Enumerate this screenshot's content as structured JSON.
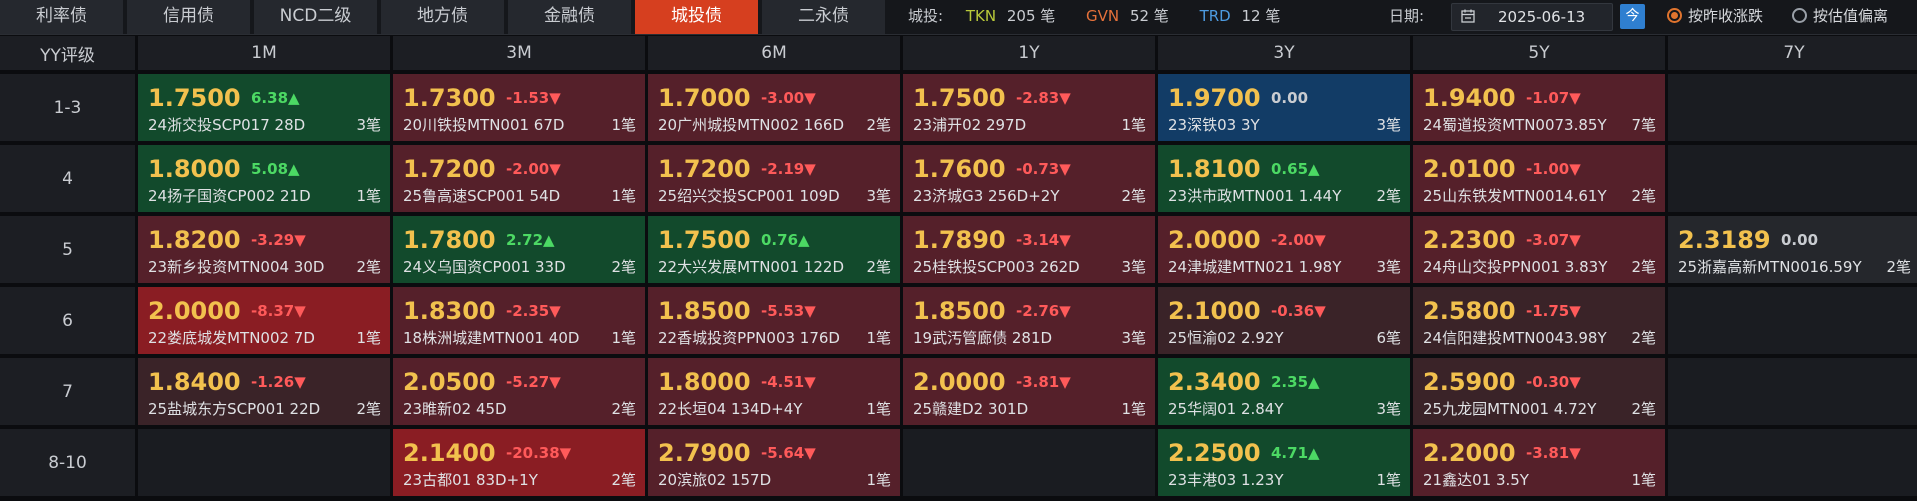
{
  "tabs": [
    {
      "label": "利率债",
      "active": false
    },
    {
      "label": "信用债",
      "active": false
    },
    {
      "label": "NCD二级",
      "active": false
    },
    {
      "label": "地方债",
      "active": false
    },
    {
      "label": "金融债",
      "active": false
    },
    {
      "label": "城投债",
      "active": true
    },
    {
      "label": "二永债",
      "active": false
    }
  ],
  "stats": {
    "label": "城投:",
    "tkn_label": "TKN",
    "tkn_value": "205 笔",
    "gvn_label": "GVN",
    "gvn_value": "52 笔",
    "trd_label": "TRD",
    "trd_value": "12 笔"
  },
  "date": {
    "label": "日期:",
    "value": "2025-06-13",
    "today_label": "今"
  },
  "sort_options": [
    {
      "label": "按昨收涨跌",
      "selected": true
    },
    {
      "label": "按估值偏离",
      "selected": false
    }
  ],
  "colors": {
    "accent": "#d63f1f",
    "up": "#4cd964",
    "down": "#ff5a5a",
    "yield": "#f2c14e",
    "today": "#2f7fd0"
  },
  "grid": {
    "corner": "YY评级",
    "columns": [
      "1M",
      "3M",
      "6M",
      "1Y",
      "3Y",
      "5Y",
      "7Y"
    ],
    "rows": [
      {
        "rating": "1-3",
        "cells": [
          {
            "tone": "g",
            "yield": "1.7500",
            "change": "6.38▲",
            "dir": "up",
            "bond": "24浙交投SCP017 28D",
            "count": "3笔"
          },
          {
            "tone": "r",
            "yield": "1.7300",
            "change": "-1.53▼",
            "dir": "dn",
            "bond": "20川铁投MTN001 67D",
            "count": "1笔"
          },
          {
            "tone": "r",
            "yield": "1.7000",
            "change": "-3.00▼",
            "dir": "dn",
            "bond": "20广州城投MTN002 166D",
            "count": "2笔"
          },
          {
            "tone": "r",
            "yield": "1.7500",
            "change": "-2.83▼",
            "dir": "dn",
            "bond": "23浦开02 297D",
            "count": "1笔"
          },
          {
            "tone": "b",
            "yield": "1.9700",
            "change": "0.00",
            "dir": "flat",
            "bond": "23深铁03 3Y",
            "count": "3笔"
          },
          {
            "tone": "r",
            "yield": "1.9400",
            "change": "-1.07▼",
            "dir": "dn",
            "bond": "24蜀道投资MTN0073.85Y",
            "count": "7笔"
          },
          null
        ]
      },
      {
        "rating": "4",
        "cells": [
          {
            "tone": "g",
            "yield": "1.8000",
            "change": "5.08▲",
            "dir": "up",
            "bond": "24扬子国资CP002 21D",
            "count": "1笔"
          },
          {
            "tone": "r",
            "yield": "1.7200",
            "change": "-2.00▼",
            "dir": "dn",
            "bond": "25鲁高速SCP001 54D",
            "count": "1笔"
          },
          {
            "tone": "r",
            "yield": "1.7200",
            "change": "-2.19▼",
            "dir": "dn",
            "bond": "25绍兴交投SCP001 109D",
            "count": "3笔"
          },
          {
            "tone": "r",
            "yield": "1.7600",
            "change": "-0.73▼",
            "dir": "dn",
            "bond": "23济城G3 256D+2Y",
            "count": "2笔"
          },
          {
            "tone": "g",
            "yield": "1.8100",
            "change": "0.65▲",
            "dir": "up",
            "bond": "23洪市政MTN001 1.44Y",
            "count": "2笔"
          },
          {
            "tone": "r",
            "yield": "2.0100",
            "change": "-1.00▼",
            "dir": "dn",
            "bond": "25山东铁发MTN0014.61Y",
            "count": "2笔"
          },
          null
        ]
      },
      {
        "rating": "5",
        "cells": [
          {
            "tone": "r",
            "yield": "1.8200",
            "change": "-3.29▼",
            "dir": "dn",
            "bond": "23新乡投资MTN004 30D",
            "count": "2笔"
          },
          {
            "tone": "g",
            "yield": "1.7800",
            "change": "2.72▲",
            "dir": "up",
            "bond": "24义乌国资CP001 33D",
            "count": "2笔"
          },
          {
            "tone": "g",
            "yield": "1.7500",
            "change": "0.76▲",
            "dir": "up",
            "bond": "22大兴发展MTN001 122D",
            "count": "2笔"
          },
          {
            "tone": "r",
            "yield": "1.7890",
            "change": "-3.14▼",
            "dir": "dn",
            "bond": "25桂铁投SCP003 262D",
            "count": "3笔"
          },
          {
            "tone": "r",
            "yield": "2.0000",
            "change": "-2.00▼",
            "dir": "dn",
            "bond": "24津城建MTN021 1.98Y",
            "count": "3笔"
          },
          {
            "tone": "r",
            "yield": "2.2300",
            "change": "-3.07▼",
            "dir": "dn",
            "bond": "24舟山交投PPN001 3.83Y",
            "count": "2笔"
          },
          {
            "tone": "n",
            "yield": "2.3189",
            "change": "0.00",
            "dir": "flat",
            "bond": "25浙嘉高新MTN0016.59Y",
            "count": "2笔"
          }
        ]
      },
      {
        "rating": "6",
        "cells": [
          {
            "tone": "rr",
            "yield": "2.0000",
            "change": "-8.37▼",
            "dir": "dn",
            "bond": "22娄底城发MTN002 7D",
            "count": "1笔"
          },
          {
            "tone": "r",
            "yield": "1.8300",
            "change": "-2.35▼",
            "dir": "dn",
            "bond": "18株洲城建MTN001 40D",
            "count": "1笔"
          },
          {
            "tone": "r",
            "yield": "1.8500",
            "change": "-5.53▼",
            "dir": "dn",
            "bond": "22香城投资PPN003 176D",
            "count": "1笔"
          },
          {
            "tone": "r",
            "yield": "1.8500",
            "change": "-2.76▼",
            "dir": "dn",
            "bond": "19武汚管廊债 281D",
            "count": "3笔"
          },
          {
            "tone": "dr",
            "yield": "2.1000",
            "change": "-0.36▼",
            "dir": "dn",
            "bond": "25恒渝02 2.92Y",
            "count": "6笔"
          },
          {
            "tone": "dr",
            "yield": "2.5800",
            "change": "-1.75▼",
            "dir": "dn",
            "bond": "24信阳建投MTN0043.98Y",
            "count": "2笔"
          },
          null
        ]
      },
      {
        "rating": "7",
        "cells": [
          {
            "tone": "dr",
            "yield": "1.8400",
            "change": "-1.26▼",
            "dir": "dn",
            "bond": "25盐城东方SCP001 22D",
            "count": "2笔"
          },
          {
            "tone": "r",
            "yield": "2.0500",
            "change": "-5.27▼",
            "dir": "dn",
            "bond": "23睢新02 45D",
            "count": "2笔"
          },
          {
            "tone": "r",
            "yield": "1.8000",
            "change": "-4.51▼",
            "dir": "dn",
            "bond": "22长垣04 134D+4Y",
            "count": "1笔"
          },
          {
            "tone": "r",
            "yield": "2.0000",
            "change": "-3.81▼",
            "dir": "dn",
            "bond": "25赣建D2 301D",
            "count": "1笔"
          },
          {
            "tone": "g",
            "yield": "2.3400",
            "change": "2.35▲",
            "dir": "up",
            "bond": "25华阔01 2.84Y",
            "count": "3笔"
          },
          {
            "tone": "dr",
            "yield": "2.5900",
            "change": "-0.30▼",
            "dir": "dn",
            "bond": "25九龙园MTN001 4.72Y",
            "count": "2笔"
          },
          null
        ]
      },
      {
        "rating": "8-10",
        "cells": [
          null,
          {
            "tone": "rr",
            "yield": "2.1400",
            "change": "-20.38▼",
            "dir": "dn",
            "bond": "23古都01 83D+1Y",
            "count": "2笔"
          },
          {
            "tone": "r",
            "yield": "2.7900",
            "change": "-5.64▼",
            "dir": "dn",
            "bond": "20滨旅02 157D",
            "count": "1笔"
          },
          null,
          {
            "tone": "g",
            "yield": "2.2500",
            "change": "4.71▲",
            "dir": "up",
            "bond": "23丰港03 1.23Y",
            "count": "1笔"
          },
          {
            "tone": "r",
            "yield": "2.2000",
            "change": "-3.81▼",
            "dir": "dn",
            "bond": "21鑫达01 3.5Y",
            "count": "1笔"
          },
          null
        ]
      }
    ]
  }
}
